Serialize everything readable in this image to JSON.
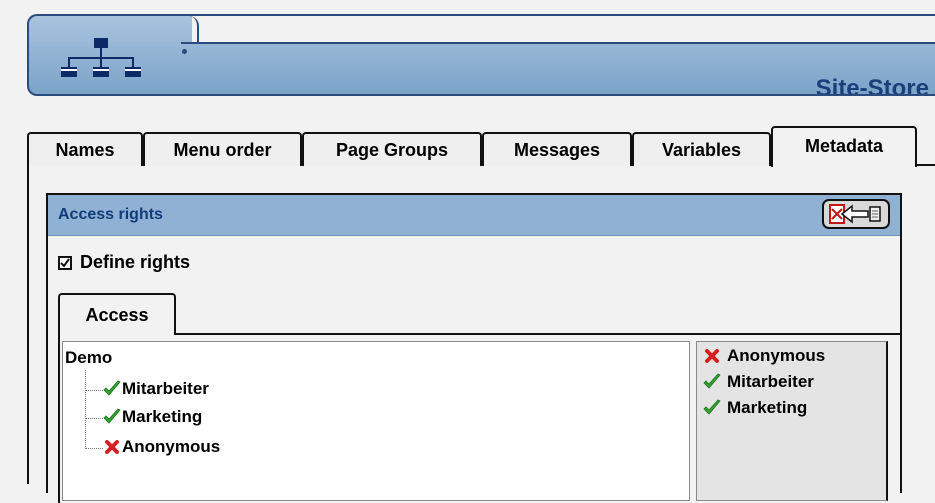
{
  "header": {
    "title": "Site-Store",
    "logo_icon": "sitemap-icon"
  },
  "tabs": [
    {
      "label": "Names",
      "active": false
    },
    {
      "label": "Menu order",
      "active": false
    },
    {
      "label": "Page Groups",
      "active": false
    },
    {
      "label": "Messages",
      "active": false
    },
    {
      "label": "Variables",
      "active": false
    },
    {
      "label": "Metadata",
      "active": true
    }
  ],
  "access_rights": {
    "title": "Access rights",
    "action_icon": "return-arrow-icon",
    "define_rights_label": "Define rights",
    "define_rights_checked": true,
    "subtab_label": "Access"
  },
  "tree": {
    "root": "Demo",
    "items": [
      {
        "label": "Mitarbeiter",
        "status_icon": "check-icon"
      },
      {
        "label": "Marketing",
        "status_icon": "check-icon"
      },
      {
        "label": "Anonymous",
        "status_icon": "cross-icon"
      }
    ]
  },
  "legend": {
    "items": [
      {
        "label": "Anonymous",
        "status_icon": "cross-icon"
      },
      {
        "label": "Mitarbeiter",
        "status_icon": "check-icon"
      },
      {
        "label": "Marketing",
        "status_icon": "check-icon"
      }
    ]
  },
  "colors": {
    "header_border": "#2a4c7c",
    "title_blue": "#1b3f7a",
    "bar_blue": "#8fb1d3",
    "check_green": "#2fa82f",
    "cross_red": "#d42020"
  }
}
